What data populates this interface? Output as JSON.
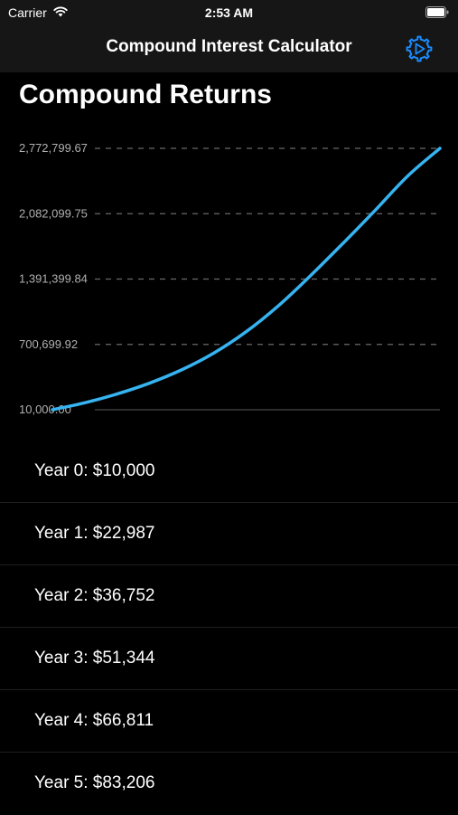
{
  "status_bar": {
    "carrier": "Carrier",
    "time": "2:53 AM"
  },
  "nav": {
    "title": "Compound Interest Calculator",
    "settings_icon": "gear-icon"
  },
  "section_title": "Compound Returns",
  "colors": {
    "accent": "#1a8cff",
    "line": "#36b3f0",
    "background": "#000000",
    "bar": "#161616"
  },
  "chart_data": {
    "type": "line",
    "title": "",
    "xlabel": "",
    "ylabel": "",
    "grid": true,
    "ylim": [
      10000,
      2772799.67
    ],
    "y_tick_labels": [
      "10,000.00",
      "700,699.92",
      "1,391,399.84",
      "2,082,099.75",
      "2,772,799.67"
    ],
    "x": [
      0,
      5,
      10,
      15,
      20,
      25,
      30,
      35,
      40,
      45,
      50,
      55,
      60
    ],
    "values": [
      10000,
      83206,
      176500,
      290500,
      432000,
      610000,
      835000,
      1110000,
      1430000,
      1770000,
      2120000,
      2480000,
      2772799.67
    ]
  },
  "year_rows": [
    {
      "label": "Year 0: $10,000"
    },
    {
      "label": "Year 1: $22,987"
    },
    {
      "label": "Year 2: $36,752"
    },
    {
      "label": "Year 3: $51,344"
    },
    {
      "label": "Year 4: $66,811"
    },
    {
      "label": "Year 5: $83,206"
    }
  ]
}
